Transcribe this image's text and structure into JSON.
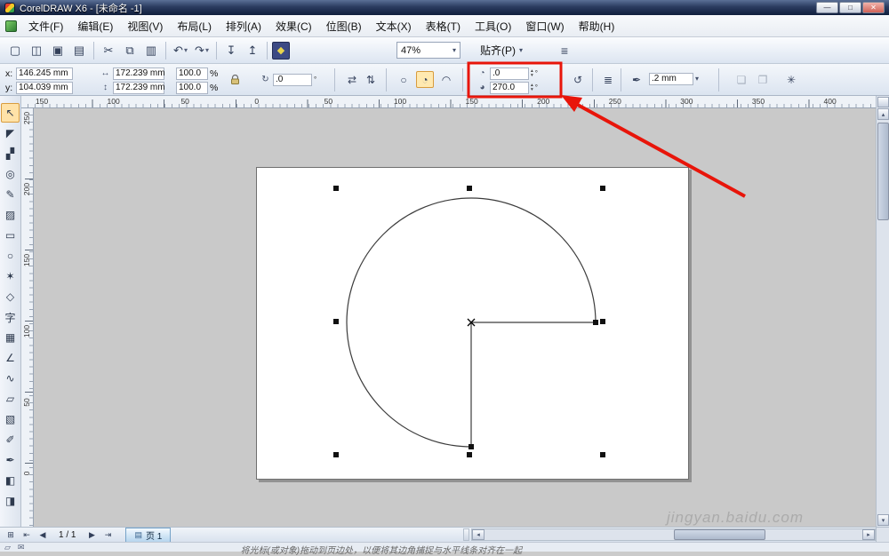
{
  "window": {
    "title": "CorelDRAW X6 - [未命名 -1]",
    "minimize_glyph": "—",
    "maximize_glyph": "□",
    "close_glyph": "✕"
  },
  "menu": {
    "items": [
      "文件(F)",
      "编辑(E)",
      "视图(V)",
      "布局(L)",
      "排列(A)",
      "效果(C)",
      "位图(B)",
      "文本(X)",
      "表格(T)",
      "工具(O)",
      "窗口(W)",
      "帮助(H)"
    ]
  },
  "standard_toolbar": {
    "buttons": [
      {
        "name": "new-document-button",
        "glyph": "▢"
      },
      {
        "name": "open-button",
        "glyph": "◫"
      },
      {
        "name": "save-button",
        "glyph": "▣"
      },
      {
        "name": "print-button",
        "glyph": "▤"
      },
      {
        "sep": true
      },
      {
        "name": "cut-button",
        "glyph": "✂"
      },
      {
        "name": "copy-button",
        "glyph": "⧉"
      },
      {
        "name": "paste-button",
        "glyph": "▥"
      },
      {
        "sep": true
      },
      {
        "name": "undo-button",
        "glyph": "↶",
        "dropdown": true
      },
      {
        "name": "redo-button",
        "glyph": "↷",
        "dropdown": true
      },
      {
        "sep": true
      },
      {
        "name": "import-button",
        "glyph": "↧"
      },
      {
        "name": "export-button",
        "glyph": "↥"
      },
      {
        "sep": true
      },
      {
        "name": "application-launcher-button",
        "glyph": "◆",
        "dark": true
      }
    ],
    "zoom_value": "47%",
    "snap_label": "贴齐(P)",
    "options_glyph": "≡",
    "combo_arrow_glyph": "▾"
  },
  "property_bar": {
    "x_label": "x:",
    "x_value": "146.245 mm",
    "y_label": "y:",
    "y_value": "104.039 mm",
    "width_value": "172.239 mm",
    "height_value": "172.239 mm",
    "scale_x_value": "100.0",
    "scale_y_value": "100.0",
    "percent_sign": "%",
    "rotation_value": ".0",
    "degree_sign": "°",
    "pie_start_angle": ".0",
    "pie_end_angle": "270.0",
    "outline_width_value": ".2 mm",
    "icons": {
      "width": "↔",
      "height": "↕",
      "rotation": "↻",
      "mirror_h": "⇄",
      "mirror_v": "⇅",
      "ellipse": "○",
      "pie": "◔",
      "arc": "◠",
      "start_angle": "◔",
      "end_angle": "◕",
      "direction": "↺",
      "wrap": "≣",
      "outline_pen": "✒",
      "grayed1": "❏",
      "grayed2": "❐",
      "customize": "✳",
      "spin_up": "▴",
      "spin_down": "▾",
      "combo_arrow": "▾"
    }
  },
  "rulers": {
    "horizontal": [
      "150",
      "100",
      "50",
      "0",
      "50",
      "100",
      "150",
      "200",
      "250",
      "300",
      "350",
      "400"
    ],
    "vertical": [
      "250",
      "200",
      "150",
      "100",
      "50",
      "0"
    ]
  },
  "toolbox": {
    "tools": [
      {
        "name": "pick-tool",
        "glyph": "↖",
        "active": true
      },
      {
        "name": "shape-tool",
        "glyph": "◤"
      },
      {
        "name": "crop-tool",
        "glyph": "▞"
      },
      {
        "name": "zoom-tool",
        "glyph": "◎"
      },
      {
        "name": "freehand-tool",
        "glyph": "✎"
      },
      {
        "name": "smart-fill-tool",
        "glyph": "▨"
      },
      {
        "name": "rectangle-tool",
        "glyph": "▭"
      },
      {
        "name": "ellipse-tool",
        "glyph": "○"
      },
      {
        "name": "polygon-tool",
        "glyph": "✶"
      },
      {
        "name": "basic-shapes-tool",
        "glyph": "◇"
      },
      {
        "name": "text-tool",
        "glyph": "字"
      },
      {
        "name": "table-tool",
        "glyph": "▦"
      },
      {
        "name": "dimension-tool",
        "glyph": "∠"
      },
      {
        "name": "connector-tool",
        "glyph": "∿"
      },
      {
        "name": "blend-tool",
        "glyph": "▱"
      },
      {
        "name": "transparency-tool",
        "glyph": "▧"
      },
      {
        "name": "eyedropper-tool",
        "glyph": "✐"
      },
      {
        "name": "outline-pen-tool",
        "glyph": "✒"
      },
      {
        "name": "fill-tool",
        "glyph": "◧"
      },
      {
        "name": "interactive-fill-tool",
        "glyph": "◨"
      }
    ]
  },
  "canvas": {
    "shape": {
      "type": "pie",
      "start_angle": "0",
      "end_angle": "270"
    }
  },
  "page_bar": {
    "add_page_glyph": "⊞",
    "first_page_glyph": "⇤",
    "prev_page_glyph": "◀",
    "next_page_glyph": "▶",
    "last_page_glyph": "⇥",
    "page_indicator": "1 / 1",
    "tab_icon_glyph": "▤",
    "page_tab_label": "页 1"
  },
  "scrollbar": {
    "up": "▴",
    "down": "▾",
    "left": "◂",
    "right": "▸"
  },
  "status_bar": {
    "icon1": "▱",
    "icon2": "✉",
    "hint": "将光标(或对象)拖动到页边处，以便将其边角捕捉与水平线条对齐在一起"
  },
  "watermark": "jingyan.baidu.com",
  "annotation_color": "#e8150a"
}
